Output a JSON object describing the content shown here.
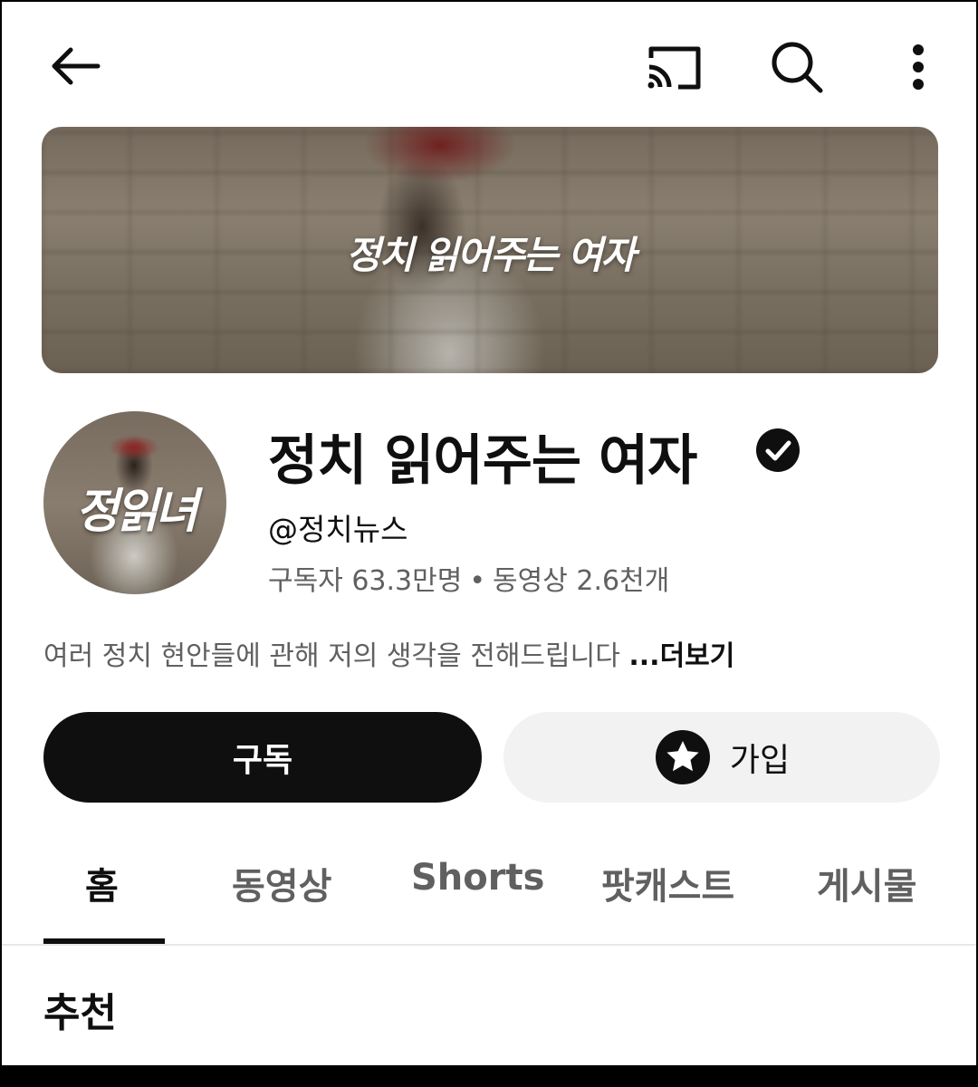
{
  "topbar": {
    "back_icon": "arrow-left-icon",
    "cast_icon": "cast-icon",
    "search_icon": "search-icon",
    "more_icon": "more-vertical-icon"
  },
  "banner": {
    "title": "정치 읽어주는 여자"
  },
  "channel": {
    "avatar_text": "정읽녀",
    "name": "정치 읽어주는 여자",
    "verified": true,
    "handle": "@정치뉴스",
    "subscribers": "구독자 63.3만명",
    "separator": "•",
    "videos": "동영상 2.6천개",
    "description": "여러 정치 현안들에 관해 저의 생각을 전해드립니다",
    "more_label": "...더보기"
  },
  "actions": {
    "subscribe_label": "구독",
    "join_label": "가입",
    "join_icon": "star-circle-icon"
  },
  "tabs": [
    {
      "label": "홈",
      "active": true
    },
    {
      "label": "동영상",
      "active": false
    },
    {
      "label": "Shorts",
      "active": false
    },
    {
      "label": "팟캐스트",
      "active": false
    },
    {
      "label": "게시물",
      "active": false
    }
  ],
  "section": {
    "title": "추천"
  },
  "colors": {
    "primary_text": "#0f0f0f",
    "secondary_text": "#606060",
    "join_bg": "#f2f2f2"
  }
}
